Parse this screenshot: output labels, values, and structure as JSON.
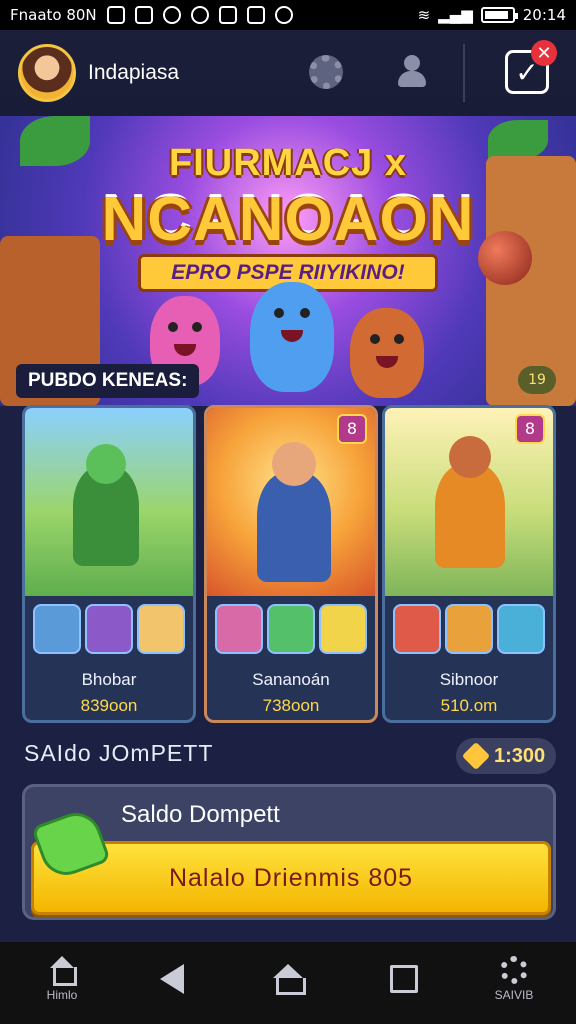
{
  "status_bar": {
    "left_text": "Fnaato 80N",
    "icons": [
      "qr-icon",
      "camera-icon",
      "sync-icon",
      "alarm-icon",
      "grid-icon",
      "refresh-icon",
      "info-icon"
    ],
    "time": "20:14",
    "battery_level": 0.9
  },
  "header": {
    "title": "Indapiasa",
    "notification_badge": "✕",
    "icons": [
      "avatar",
      "gear-icon",
      "person-icon",
      "checklist-icon"
    ]
  },
  "hero": {
    "title_line1": "FIURMACJ x",
    "title_line2": "NCANOAON",
    "subtitle": "EPRO PSPE RIIYIKINO!"
  },
  "section": {
    "label": "PUBDO KENEAS:",
    "badge": "19"
  },
  "cards": [
    {
      "name": "Bhobar",
      "price": "839oon",
      "tag": "",
      "colors": {
        "art": "#5fae4e",
        "figure": "#3c8f3a"
      },
      "items": [
        "crossbow-icon",
        "egg-icon",
        "pet-icon"
      ]
    },
    {
      "name": "Sananoán",
      "price": "738oon",
      "tag": "8",
      "colors": {
        "art": "#f7a33a",
        "figure": "#3a5fae"
      },
      "items": [
        "cat-icon",
        "gem-icon",
        "seven-icon"
      ]
    },
    {
      "name": "Sibnoor",
      "price": "510.om",
      "tag": "8",
      "colors": {
        "art": "#a7c75a",
        "figure": "#e58a24"
      },
      "items": [
        "book-icon",
        "chest-icon",
        "potion-icon"
      ]
    }
  ],
  "balance": {
    "label": "SAIdo JOmPETT",
    "coin_value": "1:300"
  },
  "wallet": {
    "title": "Saldo Dompett",
    "button_label": "Nalalo Drienmis 805"
  },
  "nav": {
    "left_label": "Himlo",
    "right_label": "SAIVIB"
  },
  "colors": {
    "accent_yellow": "#ffc93a",
    "header_bg": "#1b1f3a",
    "main_bg": "#1c2144",
    "card_border": "#4a6f9c",
    "price_yellow": "#ffd94a"
  }
}
